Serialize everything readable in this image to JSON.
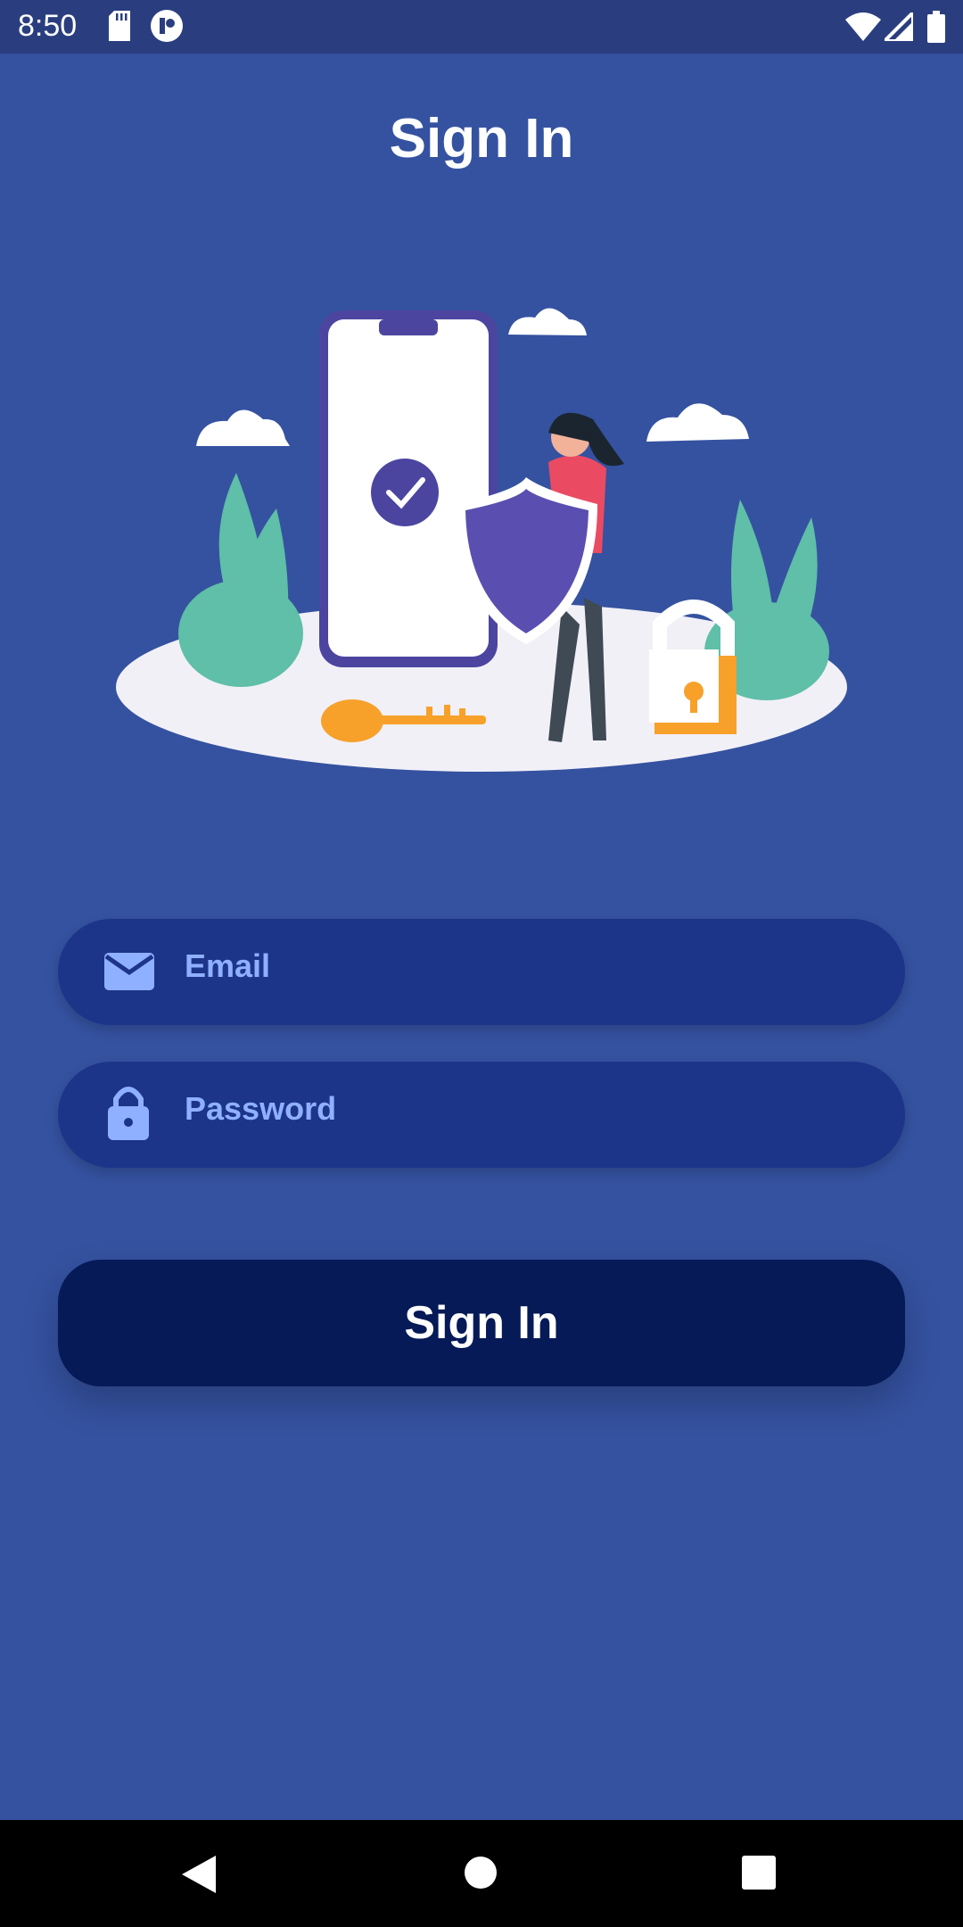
{
  "status_bar": {
    "time": "8:50",
    "left_icons": [
      "sd-card-icon",
      "app-notification-icon"
    ],
    "right_icons": [
      "wifi-icon",
      "signal-icon",
      "battery-icon"
    ]
  },
  "header": {
    "title": "Sign In"
  },
  "illustration": {
    "name": "security-illustration"
  },
  "form": {
    "email": {
      "placeholder": "Email",
      "icon": "email-icon"
    },
    "password": {
      "placeholder": "Password",
      "icon": "lock-icon"
    },
    "submit_label": "Sign In"
  },
  "nav_bar": {
    "buttons": [
      "back-icon",
      "home-icon",
      "recents-icon"
    ]
  },
  "colors": {
    "background": "#3552a0",
    "status_bar": "#2a3e7f",
    "field": "#1c3588",
    "field_text": "#8fb0ff",
    "button": "#051a57",
    "accent_orange": "#f7a12b",
    "accent_green": "#5fbfa8",
    "accent_purple": "#4c45a0"
  }
}
